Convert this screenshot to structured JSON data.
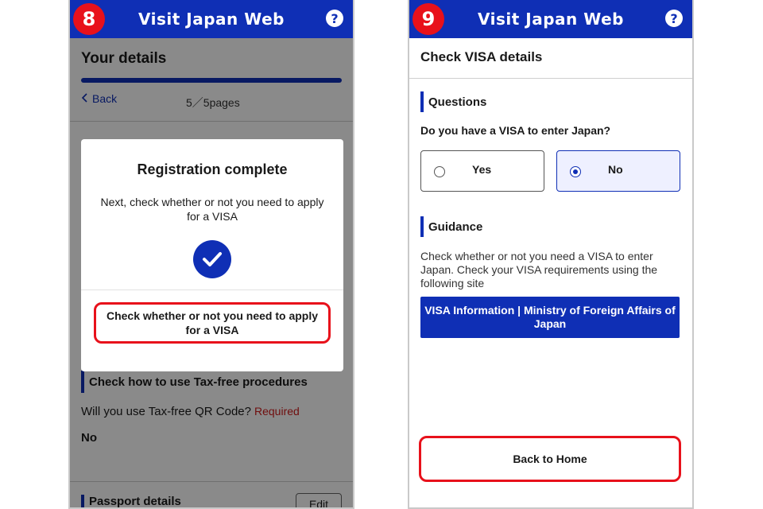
{
  "screen8": {
    "step_number": "8",
    "header_title": "Visit Japan Web",
    "help_glyph": "?",
    "page_title": "Your details",
    "back_label": "Back",
    "pages_indicator": "5／5pages",
    "section_tax_free": "Check how to use Tax-free procedures",
    "question_tax_free": "Will you use Tax-free QR Code?",
    "required_label": "Required",
    "answer_tax_free": "No",
    "section_passport": "Passport details",
    "edit_label": "Edit",
    "modal": {
      "title": "Registration complete",
      "text": "Next, check whether or not you need to apply for a VISA",
      "icon": "check-icon",
      "button_label": "Check whether or not you need to apply for a VISA"
    }
  },
  "screen9": {
    "step_number": "9",
    "header_title": "Visit Japan Web",
    "help_glyph": "?",
    "page_title": "Check VISA details",
    "questions_heading": "Questions",
    "question": "Do you have a VISA to enter Japan?",
    "options": [
      {
        "label": "Yes",
        "selected": false
      },
      {
        "label": "No",
        "selected": true
      }
    ],
    "guidance_heading": "Guidance",
    "guidance_text": "Check whether or not you need a VISA to enter Japan. Check your VISA requirements using the following site",
    "link_button": "VISA Information | Ministry of Foreign Affairs of Japan",
    "back_home": "Back to Home"
  },
  "colors": {
    "brand_blue": "#0f2fb5",
    "highlight_red": "#e8111b",
    "required_red": "#d01c1c"
  }
}
